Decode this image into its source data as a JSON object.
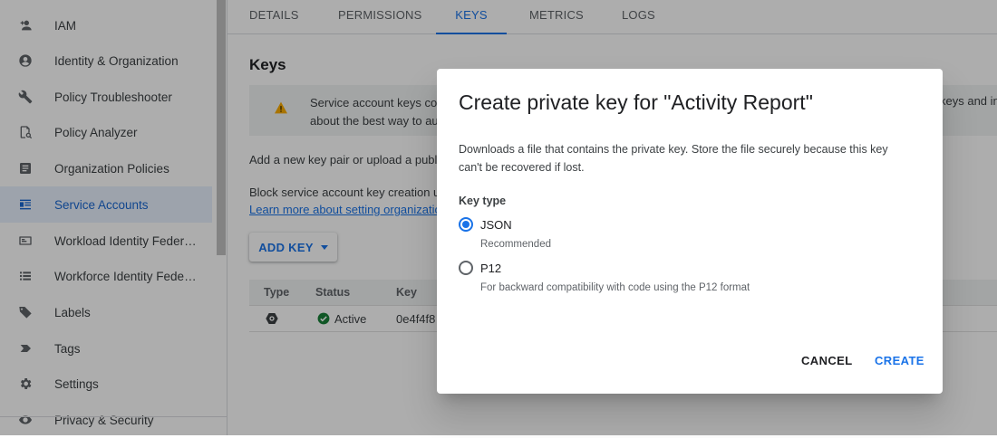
{
  "sidebar": {
    "items": [
      {
        "label": "IAM",
        "icon": "add-person-icon"
      },
      {
        "label": "Identity & Organization",
        "icon": "account-circle-icon"
      },
      {
        "label": "Policy Troubleshooter",
        "icon": "wrench-icon"
      },
      {
        "label": "Policy Analyzer",
        "icon": "document-search-icon"
      },
      {
        "label": "Organization Policies",
        "icon": "list-document-icon"
      },
      {
        "label": "Service Accounts",
        "icon": "service-account-icon",
        "active": true
      },
      {
        "label": "Workload Identity Federat...",
        "icon": "id-card-icon"
      },
      {
        "label": "Workforce Identity Federa...",
        "icon": "list-icon"
      },
      {
        "label": "Labels",
        "icon": "label-icon"
      },
      {
        "label": "Tags",
        "icon": "tag-icon"
      },
      {
        "label": "Settings",
        "icon": "gear-icon"
      },
      {
        "label": "Privacy & Security",
        "icon": "eye-icon"
      }
    ]
  },
  "tabs": [
    {
      "label": "DETAILS"
    },
    {
      "label": "PERMISSIONS"
    },
    {
      "label": "KEYS",
      "active": true
    },
    {
      "label": "METRICS"
    },
    {
      "label": "LOGS"
    }
  ],
  "main": {
    "heading": "Keys",
    "banner_line1": "Service account keys co",
    "banner_line2": "about the best way to au",
    "banner_right": "keys and in",
    "add_text": "Add a new key pair or upload a publi",
    "block_text": "Block service account key creation u",
    "learn_link": "Learn more about setting organizatio",
    "add_key_label": "ADD KEY",
    "table": {
      "headers": [
        "Type",
        "Status",
        "Key"
      ],
      "row": {
        "status": "Active",
        "key": "0e4f4f8"
      }
    }
  },
  "dialog": {
    "title": "Create private key for \"Activity Report\"",
    "description": "Downloads a file that contains the private key. Store the file securely because this key can't be recovered if lost.",
    "key_type_label": "Key type",
    "options": [
      {
        "label": "JSON",
        "sub": "Recommended",
        "selected": true
      },
      {
        "label": "P12",
        "sub": "For backward compatibility with code using the P12 format",
        "selected": false
      }
    ],
    "cancel_label": "CANCEL",
    "create_label": "CREATE"
  },
  "colors": {
    "accent": "#1a73e8",
    "active_bg": "#e8f0fe",
    "success": "#188038",
    "warning": "#f9ab00"
  }
}
